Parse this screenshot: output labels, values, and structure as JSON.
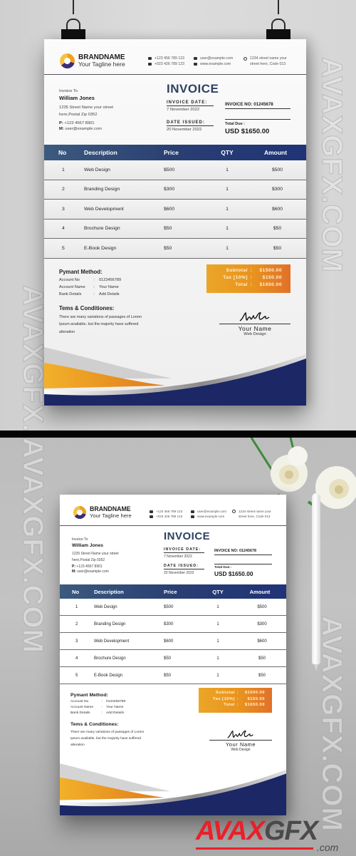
{
  "invoice": {
    "brand": {
      "name": "BRANDNAME",
      "tagline": "Your Tagline here"
    },
    "contact": {
      "phone1": "+123 456 789 123",
      "phone2": "+023 426 789 123",
      "email": "user@example.com",
      "website": "www.example.com",
      "address_line1": "1234 street name your",
      "address_line2": "street here, Code 013"
    },
    "bill_to": {
      "label": "Invoice To",
      "name": "William Jones",
      "address_line1": "1235 Street Name your street",
      "address_line2": "here,Postal Zip 0352",
      "phone_label": "P:",
      "phone": "+123 4567 8901",
      "email_label": "M:",
      "email": "user@example.com"
    },
    "title": "INVOICE",
    "invoice_date_label": "INVOICE DATE:",
    "invoice_date": "7 November 2022",
    "date_issued_label": "DATE ISSUED:",
    "date_issued": "20 November 2022",
    "invoice_no": "INVOICE NO: 01245678",
    "total_due_label": "Total Due    :",
    "total_due": "USD $1650.00",
    "table": {
      "headers": {
        "no": "No",
        "description": "Description",
        "price": "Price",
        "qty": "QTY",
        "amount": "Amount"
      },
      "rows": [
        {
          "no": "1",
          "description": "Web Design",
          "price": "$500",
          "qty": "1",
          "amount": "$500"
        },
        {
          "no": "2",
          "description": "Branding Design",
          "price": "$300",
          "qty": "1",
          "amount": "$300"
        },
        {
          "no": "3",
          "description": "Web Development",
          "price": "$600",
          "qty": "1",
          "amount": "$600"
        },
        {
          "no": "4",
          "description": "Brochure Design",
          "price": "$50",
          "qty": "1",
          "amount": "$50"
        },
        {
          "no": "5",
          "description": "E-Book Design",
          "price": "$50",
          "qty": "1",
          "amount": "$50"
        }
      ]
    },
    "payment": {
      "title": "Pymant Method:",
      "rows": [
        {
          "label": "Account No",
          "sep": ":",
          "value": "0123456789"
        },
        {
          "label": "Account Name",
          "sep": ":",
          "value": "Your Name"
        },
        {
          "label": "Bank Details",
          "sep": ":",
          "value": "Add Details"
        }
      ]
    },
    "terms": {
      "title": "Tems & Conditiones:",
      "text": "There are many variations of passages of Lorem Ipsum available, but the majority have suffered alteration"
    },
    "totals": [
      {
        "label": "Subtotal",
        "sep": ":",
        "value": "$1500.00"
      },
      {
        "label": "Tax [10%]",
        "sep": ":",
        "value": "$150.00"
      },
      {
        "label": "Total",
        "sep": ":",
        "value": "$1650.00"
      }
    ],
    "signature": {
      "name": "Your Name",
      "role": "Web Design"
    }
  },
  "colors": {
    "header_blue": "#2a3f72",
    "title_blue": "#2e4160",
    "orange": "#e9931f",
    "navy_wave": "#1c2766"
  },
  "watermark": {
    "text": "AVAXGFX.COM",
    "logo_red": "AVAX",
    "logo_gray": "GFX",
    "logo_suffix": ".com"
  }
}
